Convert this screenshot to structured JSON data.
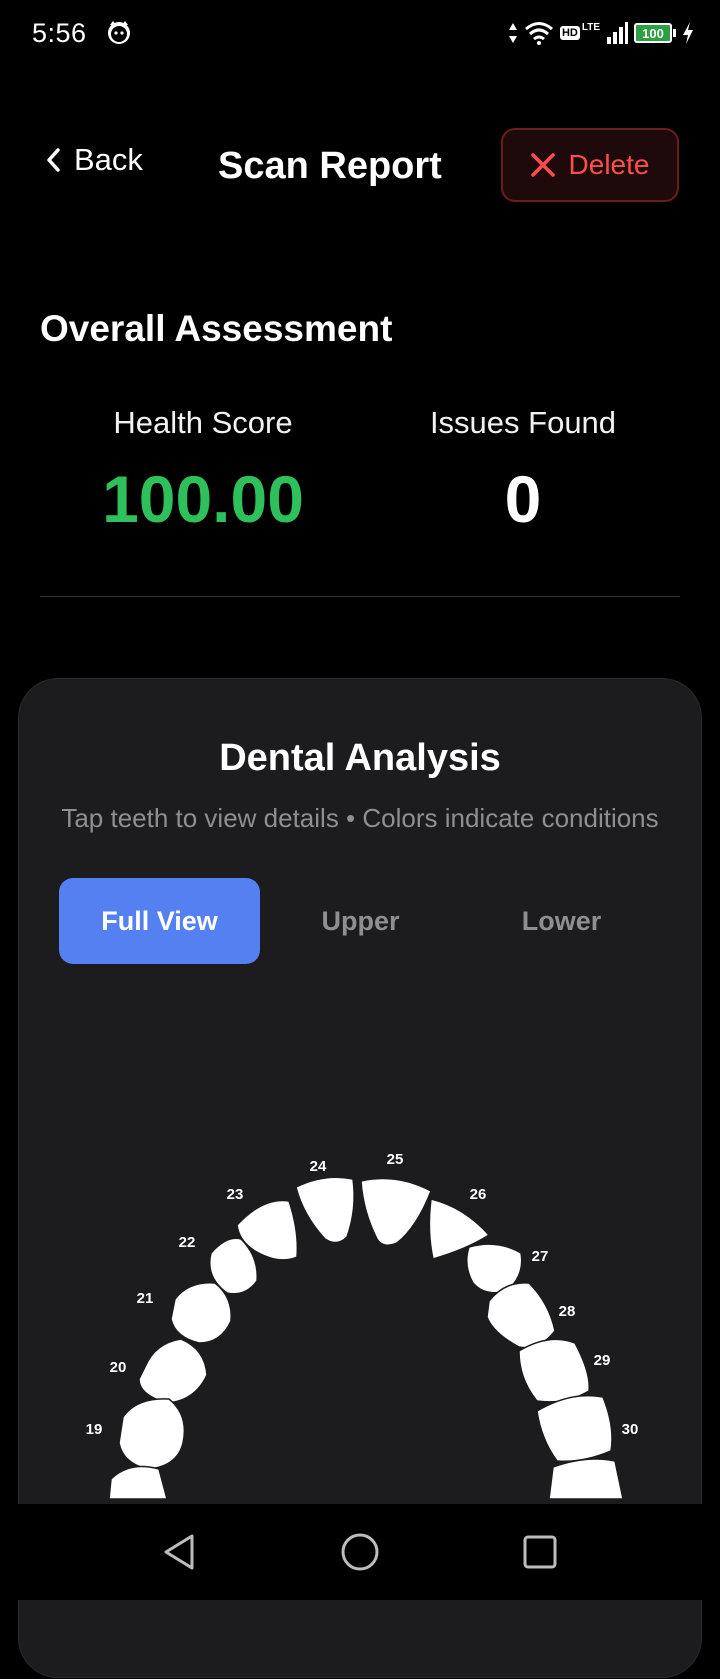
{
  "status_bar": {
    "time": "5:56",
    "battery": "100",
    "network_badge": "HD",
    "network_type": "LTE",
    "icons": [
      "cat-notification-icon",
      "data-arrows-icon",
      "wifi-icon",
      "signal-icon",
      "battery-icon",
      "charging-icon"
    ]
  },
  "header": {
    "back_label": "Back",
    "title": "Scan Report",
    "delete_label": "Delete"
  },
  "assessment": {
    "title": "Overall Assessment",
    "health_score_label": "Health Score",
    "health_score_value": "100.00",
    "issues_label": "Issues Found",
    "issues_value": "0"
  },
  "dental": {
    "title": "Dental Analysis",
    "subtitle": "Tap teeth to view details • Colors indicate conditions",
    "tabs": [
      {
        "label": "Full View",
        "active": true
      },
      {
        "label": "Upper",
        "active": false
      },
      {
        "label": "Lower",
        "active": false
      }
    ],
    "teeth": [
      {
        "number": "19"
      },
      {
        "number": "20"
      },
      {
        "number": "21"
      },
      {
        "number": "22"
      },
      {
        "number": "23"
      },
      {
        "number": "24"
      },
      {
        "number": "25"
      },
      {
        "number": "26"
      },
      {
        "number": "27"
      },
      {
        "number": "28"
      },
      {
        "number": "29"
      },
      {
        "number": "30"
      }
    ]
  },
  "colors": {
    "background": "#000000",
    "card": "#1c1c1e",
    "accent": "#5580f2",
    "health_green": "#2ec05a",
    "danger": "#ff4c4c",
    "muted_text": "#8e8e93",
    "tooth": "#ffffff"
  },
  "nav": {
    "icons": [
      "back-triangle-icon",
      "home-circle-icon",
      "recents-square-icon"
    ]
  }
}
